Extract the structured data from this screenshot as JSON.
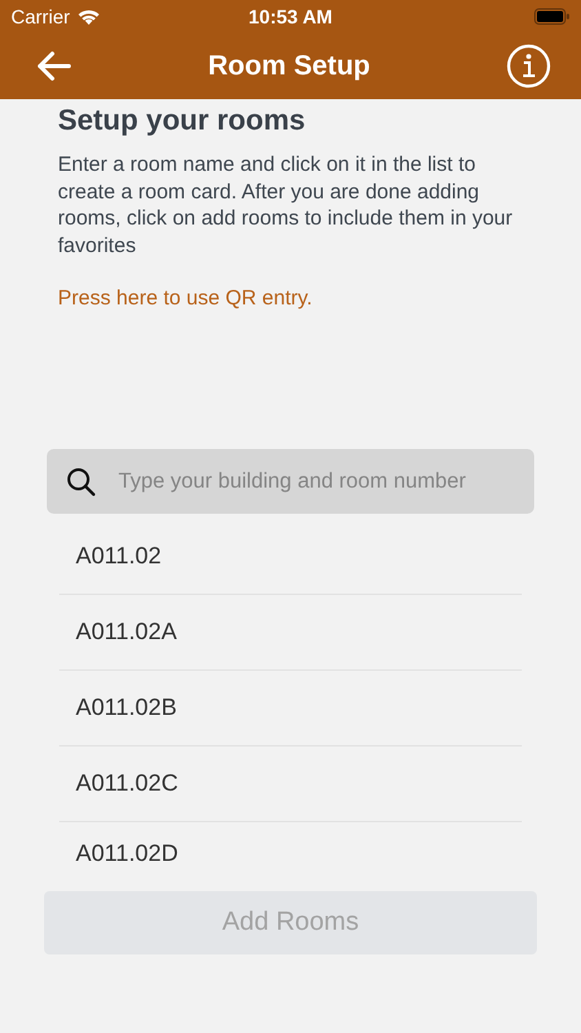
{
  "status_bar": {
    "carrier": "Carrier",
    "time": "10:53 AM"
  },
  "nav_bar": {
    "title": "Room Setup"
  },
  "heading": "Setup your rooms",
  "instructions": "Enter a room name and click on it in the list to create a room card.  After you are done adding rooms, click on add rooms to include them in your favorites",
  "qr_link": "Press here to use QR entry.",
  "search": {
    "placeholder": "Type your building and room number"
  },
  "rooms": [
    {
      "name": "A011.02"
    },
    {
      "name": "A011.02A"
    },
    {
      "name": "A011.02B"
    },
    {
      "name": "A011.02C"
    },
    {
      "name": "A011.02D"
    }
  ],
  "add_button": {
    "label": "Add Rooms",
    "disabled": true
  }
}
